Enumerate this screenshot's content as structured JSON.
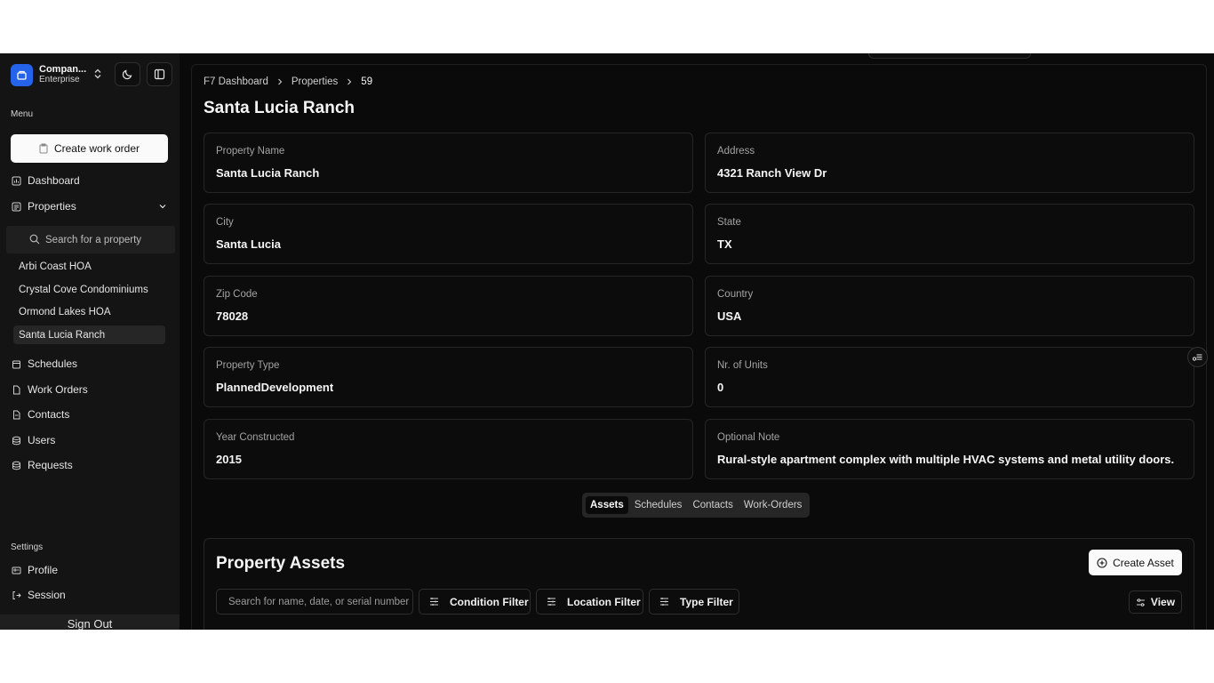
{
  "org": {
    "name": "Compan...",
    "plan": "Enterprise"
  },
  "sidebar": {
    "menu_label": "Menu",
    "create_work_order": "Create work order",
    "dashboard": "Dashboard",
    "properties": "Properties",
    "search_placeholder": "Search for a property",
    "property_list": [
      "Arbi Coast HOA",
      "Crystal Cove Condominiums",
      "Ormond Lakes HOA",
      "Santa Lucia Ranch"
    ],
    "schedules": "Schedules",
    "work_orders": "Work Orders",
    "contacts": "Contacts",
    "users": "Users",
    "requests": "Requests",
    "settings_label": "Settings",
    "profile": "Profile",
    "session": "Session",
    "sign_out": "Sign Out"
  },
  "breadcrumb": {
    "root": "F7 Dashboard",
    "section": "Properties",
    "current": "59"
  },
  "page_title": "Santa Lucia Ranch",
  "fields": {
    "property_name": {
      "label": "Property Name",
      "value": "Santa Lucia Ranch"
    },
    "address": {
      "label": "Address",
      "value": "4321 Ranch View Dr"
    },
    "city": {
      "label": "City",
      "value": "Santa Lucia"
    },
    "state": {
      "label": "State",
      "value": "TX"
    },
    "zip": {
      "label": "Zip Code",
      "value": "78028"
    },
    "country": {
      "label": "Country",
      "value": "USA"
    },
    "property_type": {
      "label": "Property Type",
      "value": "PlannedDevelopment"
    },
    "units": {
      "label": "Nr. of Units",
      "value": "0"
    },
    "year": {
      "label": "Year Constructed",
      "value": "2015"
    },
    "note": {
      "label": "Optional Note",
      "value": "Rural-style apartment complex with multiple HVAC systems and metal utility doors."
    }
  },
  "tabs": [
    "Assets",
    "Schedules",
    "Contacts",
    "Work-Orders"
  ],
  "assets": {
    "title": "Property Assets",
    "create_label": "Create Asset",
    "search_placeholder": "Search for name, date, or serial number",
    "condition_filter": "Condition Filter",
    "location_filter": "Location Filter",
    "type_filter": "Type Filter",
    "view_label": "View"
  },
  "colors": {
    "accent": "#2563eb",
    "background": "#0a0a0a",
    "sidebar": "#141414"
  }
}
